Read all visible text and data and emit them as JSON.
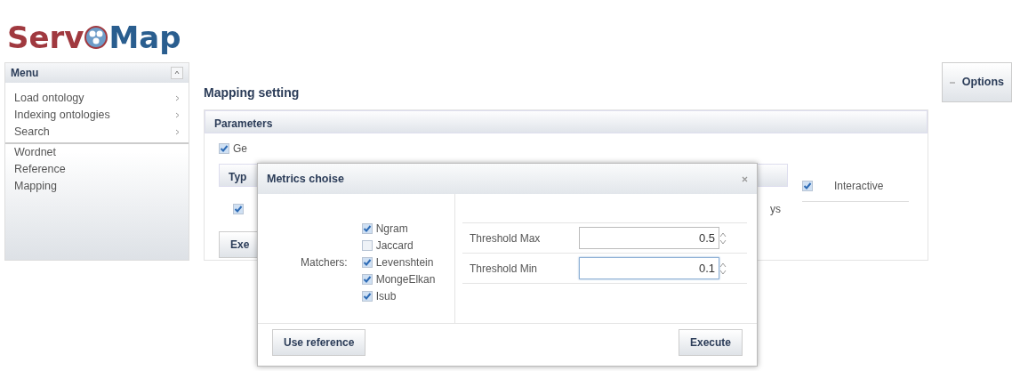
{
  "logo": {
    "before": "Serv",
    "after": "Map"
  },
  "menu": {
    "title": "Menu",
    "items": [
      {
        "label": "Load ontology",
        "submenu": true
      },
      {
        "label": "Indexing ontologies",
        "submenu": true
      },
      {
        "label": "Search",
        "submenu": true
      },
      {
        "label": "Wordnet",
        "submenu": false
      },
      {
        "label": "Reference",
        "submenu": false
      },
      {
        "label": "Mapping",
        "submenu": false
      }
    ]
  },
  "page": {
    "title": "Mapping setting",
    "options_button": "Options"
  },
  "parameters": {
    "title": "Parameters",
    "general": {
      "label": "Ge",
      "checked": true
    },
    "type_header": "Typ",
    "row_checked": true,
    "row_text": "ys",
    "interactive": {
      "label": "Interactive",
      "checked": true
    },
    "execute_fragment": "Exe"
  },
  "dialog": {
    "title": "Metrics choise",
    "matchers_label": "Matchers:",
    "matchers": [
      {
        "label": "Ngram",
        "checked": true
      },
      {
        "label": "Jaccard",
        "checked": false
      },
      {
        "label": "Levenshtein",
        "checked": true
      },
      {
        "label": "MongeElkan",
        "checked": true
      },
      {
        "label": "Isub",
        "checked": true
      }
    ],
    "thresholds": [
      {
        "label": "Threshold Max",
        "value": "0.5",
        "focused": false
      },
      {
        "label": "Threshold Min",
        "value": "0.1",
        "focused": true
      }
    ],
    "use_reference": "Use reference",
    "execute": "Execute"
  }
}
